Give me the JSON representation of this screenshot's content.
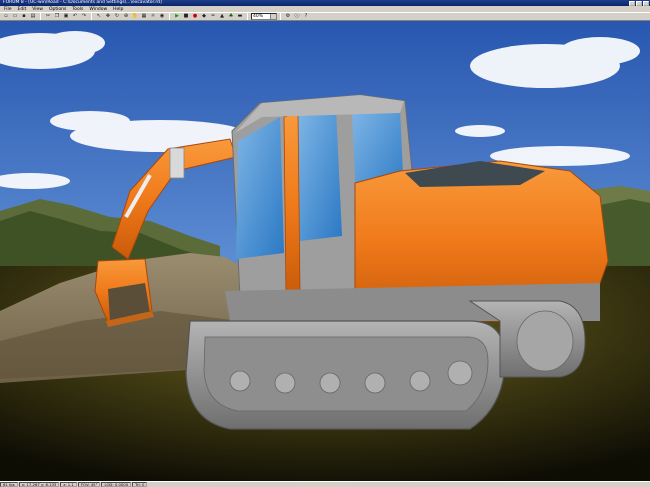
{
  "window": {
    "title": "FORUM 8 - [UC-win/Road - C:\\Documents and Settings\\...\\excavator.rd]",
    "buttons": [
      "minimize",
      "maximize",
      "close"
    ]
  },
  "menu": [
    "File",
    "Edit",
    "View",
    "Options",
    "Tools",
    "Window",
    "Help"
  ],
  "toolbar": {
    "icons": [
      "new-icon",
      "open-icon",
      "save-icon",
      "print-icon",
      "cut-icon",
      "copy-icon",
      "paste-icon",
      "undo-icon",
      "redo-icon",
      "select-icon",
      "move-icon",
      "rotate-icon",
      "zoom-icon",
      "pan-icon",
      "grid-icon",
      "light-icon",
      "camera-icon",
      "play-icon",
      "stop-icon",
      "record-icon",
      "model-icon",
      "road-icon",
      "terrain-icon",
      "tree-icon",
      "car-icon"
    ],
    "zoom_value": "40%",
    "tail_icons": [
      "settings-icon",
      "info-icon",
      "help-icon"
    ]
  },
  "status": {
    "cells": [
      "61 fps",
      "x: 17.267  y: 6.133",
      "z: 1.1",
      "FOV: 45°",
      "LOD: 0.0000",
      "Tri: 0"
    ]
  },
  "colors": {
    "excavator_body": "#f07a1a",
    "track": "#9a9a9a",
    "sky": "#2a5fb5",
    "ground": "#3d3a12"
  }
}
